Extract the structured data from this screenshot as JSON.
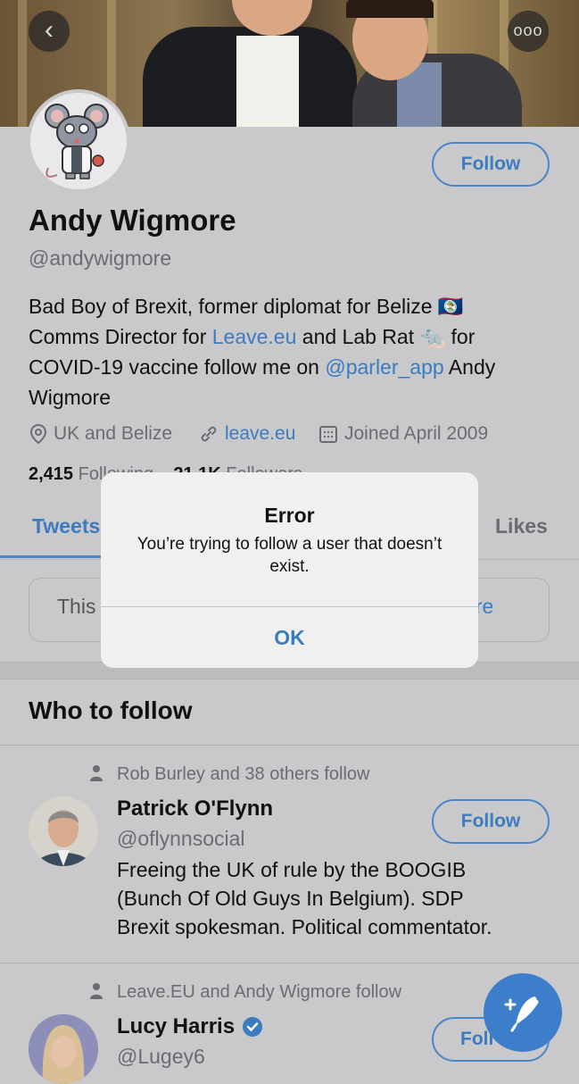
{
  "header": {
    "back_icon": "chevron-left-icon",
    "more_icon": "more-icon"
  },
  "profile": {
    "name": "Andy Wigmore",
    "handle": "@andywigmore",
    "follow_label": "Follow",
    "bio": {
      "part1": "Bad Boy of Brexit, former diplomat for Belize 🇧🇿",
      "part2": "Comms Director for ",
      "link1": "Leave.eu",
      "part3": " and Lab Rat 🐀 for",
      "part4": "COVID-19 vaccine follow me on ",
      "link2": "@parler_app",
      "part5": " Andy",
      "part6": "Wigmore"
    },
    "location": "UK and Belize",
    "website": "leave.eu",
    "joined": "Joined April 2009",
    "following_count": "2,415",
    "following_label": "Following",
    "followers_count": "21.1K",
    "followers_label": "Followers"
  },
  "tabs": [
    "Tweets",
    "Likes"
  ],
  "notice": {
    "text": "This",
    "more": "ore"
  },
  "who_to_follow": {
    "title": "Who to follow",
    "items": [
      {
        "social": "Rob Burley and 38 others follow",
        "name": "Patrick O'Flynn",
        "handle": "@oflynnsocial",
        "bio_line1": "Freeing the UK of rule by the BOOGIB",
        "bio_line2": "(Bunch Of Old Guys In Belgium). SDP",
        "bio_line3": "Brexit spokesman. Political commentator.",
        "follow_label": "Follow"
      },
      {
        "social": "Leave.EU and Andy Wigmore follow",
        "name": "Lucy Harris",
        "handle": "@Lugey6",
        "follow_label": "Foll"
      }
    ]
  },
  "dialog": {
    "title": "Error",
    "message": "You’re trying to follow a user that doesn’t exist.",
    "ok_label": "OK"
  },
  "colors": {
    "accent": "#3b7bbf",
    "background_dimmed": "#c9c9cb",
    "dialog_bg": "#f0f0f1"
  }
}
